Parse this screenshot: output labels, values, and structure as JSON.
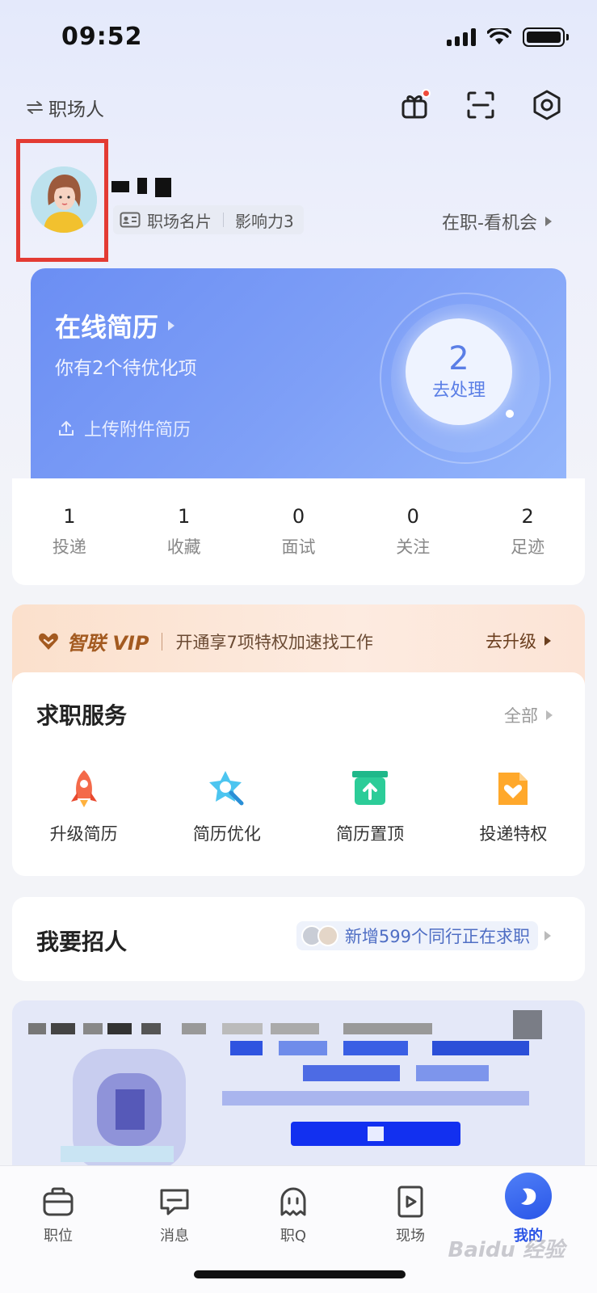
{
  "status_bar": {
    "time": "09:52"
  },
  "header": {
    "identity_switch": "职场人",
    "icons": [
      "gift-icon",
      "scan-icon",
      "settings-icon"
    ]
  },
  "profile": {
    "card_label": "职场名片",
    "influence": "影响力3",
    "job_status": "在职-看机会"
  },
  "resume": {
    "title": "在线简历",
    "subtitle": "你有2个待优化项",
    "upload": "上传附件简历",
    "pending_count": "2",
    "action": "去处理"
  },
  "stats": [
    {
      "value": "1",
      "label": "投递"
    },
    {
      "value": "1",
      "label": "收藏"
    },
    {
      "value": "0",
      "label": "面试"
    },
    {
      "value": "0",
      "label": "关注"
    },
    {
      "value": "2",
      "label": "足迹"
    }
  ],
  "vip": {
    "brand": "智联 VIP",
    "text": "开通享7项特权加速找工作",
    "action": "去升级"
  },
  "services": {
    "title": "求职服务",
    "more": "全部",
    "items": [
      {
        "label": "升级简历",
        "icon": "rocket-icon"
      },
      {
        "label": "简历优化",
        "icon": "star-magnifier-icon"
      },
      {
        "label": "简历置顶",
        "icon": "pin-top-icon"
      },
      {
        "label": "投递特权",
        "icon": "privilege-file-icon"
      }
    ]
  },
  "recruit": {
    "title": "我要招人",
    "note": "新增599个同行正在求职"
  },
  "tabbar": [
    {
      "label": "职位",
      "icon": "briefcase-icon"
    },
    {
      "label": "消息",
      "icon": "message-icon"
    },
    {
      "label": "职Q",
      "icon": "ghost-icon"
    },
    {
      "label": "现场",
      "icon": "video-icon"
    },
    {
      "label": "我的",
      "icon": "me-icon"
    }
  ],
  "watermark": "Baidu 经验",
  "colors": {
    "accent": "#2a54e6",
    "resume_card": "#7395f5",
    "vip_brown": "#a35a20",
    "highlight_box": "#e33b33"
  }
}
